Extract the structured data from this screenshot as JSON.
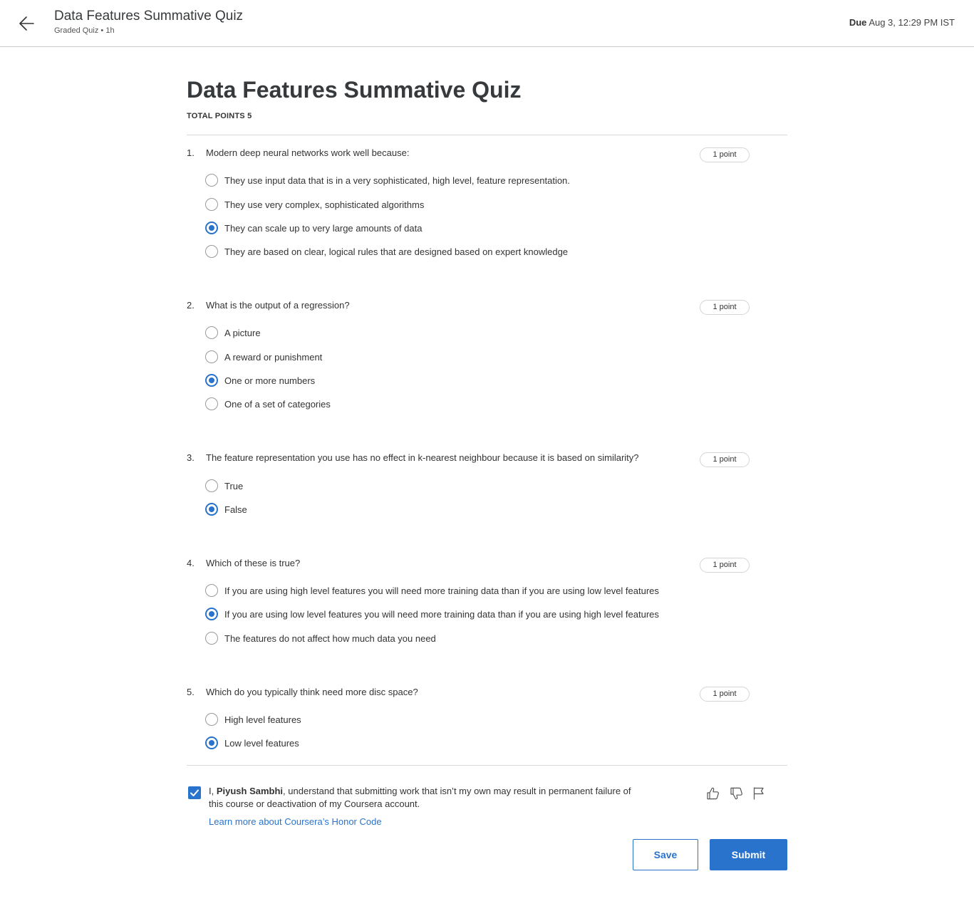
{
  "header": {
    "title": "Data Features Summative Quiz",
    "subtitle": "Graded Quiz • 1h",
    "due_label": "Due",
    "due_value": "Aug 3, 12:29 PM IST"
  },
  "quiz": {
    "title": "Data Features Summative Quiz",
    "total_points": "TOTAL POINTS 5",
    "questions": [
      {
        "number": "1.",
        "text": "Modern deep neural networks work well because:",
        "points": "1 point",
        "options": [
          {
            "label": "They use input data that is in a very sophisticated, high level, feature representation.",
            "selected": false
          },
          {
            "label": "They use very complex, sophisticated algorithms",
            "selected": false
          },
          {
            "label": "They can scale up to very large amounts of data",
            "selected": true
          },
          {
            "label": "They are based on clear, logical rules that are designed based on expert knowledge",
            "selected": false
          }
        ]
      },
      {
        "number": "2.",
        "text": "What is the output of a regression?",
        "points": "1 point",
        "options": [
          {
            "label": "A picture",
            "selected": false
          },
          {
            "label": "A reward or punishment",
            "selected": false
          },
          {
            "label": "One or more numbers",
            "selected": true
          },
          {
            "label": "One of a set of categories",
            "selected": false
          }
        ]
      },
      {
        "number": "3.",
        "text": "The feature representation you use has no effect in k-nearest neighbour because it is based on similarity?",
        "points": "1 point",
        "options": [
          {
            "label": "True",
            "selected": false
          },
          {
            "label": "False",
            "selected": true
          }
        ]
      },
      {
        "number": "4.",
        "text": "Which of these is true?",
        "points": "1 point",
        "options": [
          {
            "label": "If you are using high level features you will need more training data than if you are using low level features",
            "selected": false
          },
          {
            "label": "If you are using low level features you will need more training data than if you are using high level features",
            "selected": true
          },
          {
            "label": "The features do not affect how much data you need",
            "selected": false
          }
        ]
      },
      {
        "number": "5.",
        "text": "Which do you typically think need more disc space?",
        "points": "1 point",
        "options": [
          {
            "label": "High level features",
            "selected": false
          },
          {
            "label": "Low level features",
            "selected": true
          }
        ]
      }
    ]
  },
  "honor": {
    "checked": true,
    "prefix": "I, ",
    "name": "Piyush Sambhi",
    "text_after_name": ", understand that submitting work that isn’t my own may result in permanent failure of this course or deactivation of my Coursera account.",
    "link": "Learn more about Coursera’s Honor Code"
  },
  "actions": {
    "save": "Save",
    "submit": "Submit"
  },
  "icons": [
    "back-arrow-icon",
    "thumbs-up-icon",
    "thumbs-down-icon",
    "flag-icon",
    "checkmark-icon"
  ],
  "colors": {
    "accent": "#2a73cc",
    "text": "#333333"
  }
}
